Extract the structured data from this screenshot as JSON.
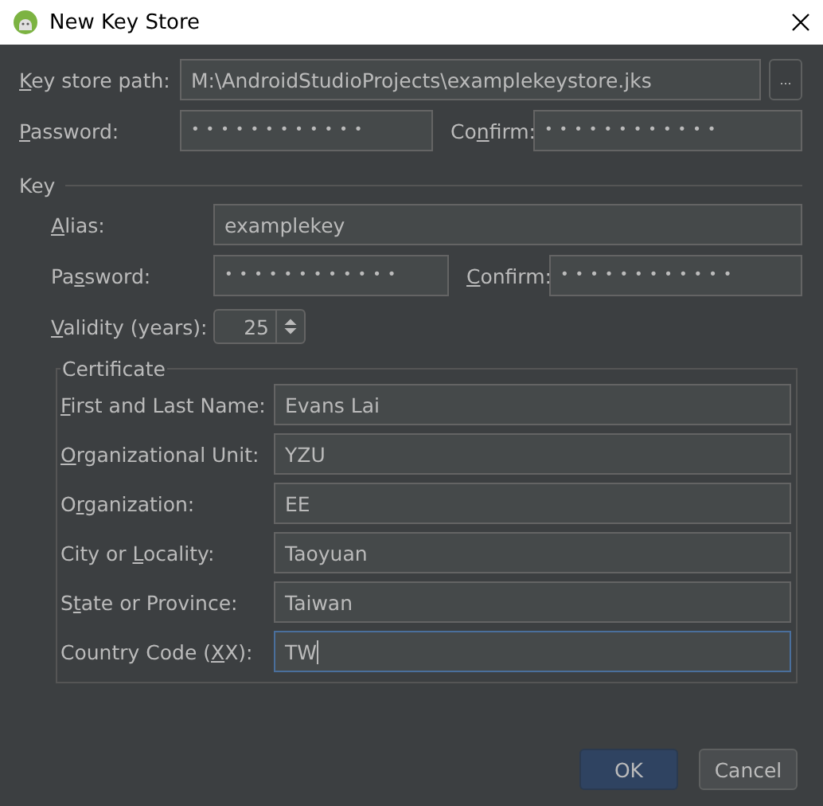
{
  "window": {
    "title": "New Key Store"
  },
  "keystore": {
    "path": {
      "label": {
        "key": "K",
        "post": "ey store path:"
      },
      "value": "M:\\AndroidStudioProjects\\examplekeystore.jks"
    },
    "browse": "...",
    "password": {
      "label": {
        "key": "P",
        "post": "assword:"
      },
      "value": "••••••••••••"
    },
    "confirm": {
      "label": {
        "pre": "Co",
        "key": "n",
        "post": "firm:"
      },
      "value": "••••••••••••"
    }
  },
  "key": {
    "title": "Key",
    "alias": {
      "label": {
        "key": "A",
        "post": "lias:"
      },
      "value": "examplekey"
    },
    "password": {
      "label": {
        "pre": "Pa",
        "key": "s",
        "post": "sword:"
      },
      "value": "••••••••••••"
    },
    "confirm": {
      "label": {
        "key": "C",
        "post": "onfirm:"
      },
      "value": "••••••••••••"
    },
    "validity": {
      "label": {
        "key": "V",
        "post": "alidity (years):"
      },
      "value": "25"
    }
  },
  "certificate": {
    "title": "Certificate",
    "fields": [
      {
        "label": {
          "key": "F",
          "post": "irst and Last Name:"
        },
        "value": "Evans Lai",
        "focused": false
      },
      {
        "label": {
          "key": "O",
          "post": "rganizational Unit:"
        },
        "value": "YZU",
        "focused": false
      },
      {
        "label": {
          "pre": "O",
          "key": "r",
          "post": "ganization:"
        },
        "value": "EE",
        "focused": false
      },
      {
        "label": {
          "pre": "City or ",
          "key": "L",
          "post": "ocality:"
        },
        "value": "Taoyuan",
        "focused": false
      },
      {
        "label": {
          "pre": "S",
          "key": "t",
          "post": "ate or Province:"
        },
        "value": "Taiwan",
        "focused": false
      },
      {
        "label": {
          "pre": "Country Code (",
          "key": "X",
          "post": "X):"
        },
        "value": "TW",
        "focused": true
      }
    ]
  },
  "buttons": [
    {
      "label": "OK",
      "default": true
    },
    {
      "label": "Cancel",
      "default": false
    }
  ]
}
